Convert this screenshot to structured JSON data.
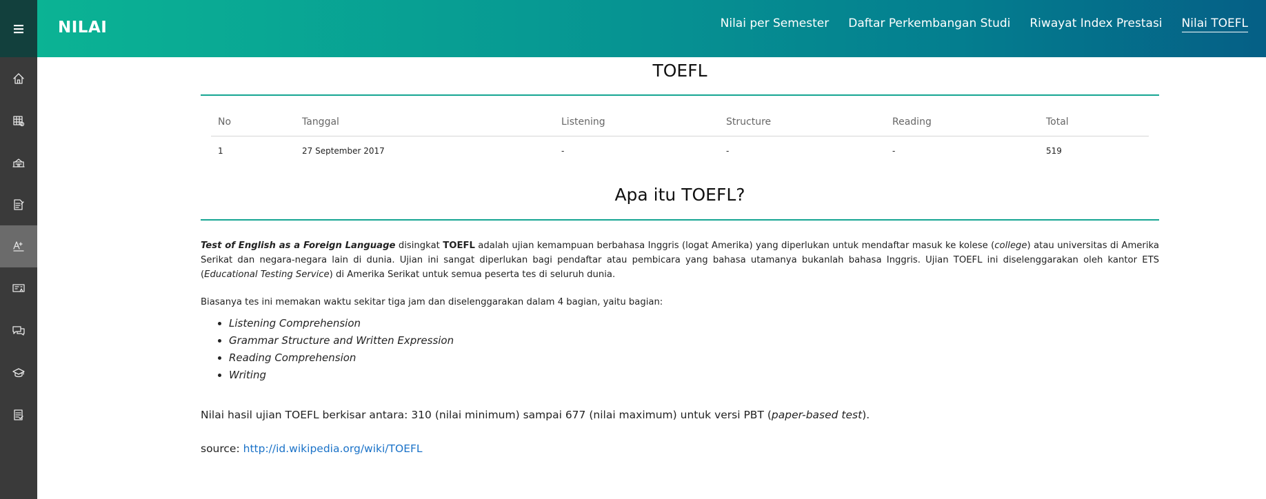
{
  "header": {
    "brand": "NILAI",
    "nav": [
      {
        "label": "Nilai per Semester",
        "active": false
      },
      {
        "label": "Daftar Perkembangan Studi",
        "active": false
      },
      {
        "label": "Riwayat Index Prestasi",
        "active": false
      },
      {
        "label": "Nilai TOEFL",
        "active": true
      }
    ]
  },
  "sidebar": {
    "items": [
      {
        "icon": "home-icon"
      },
      {
        "icon": "schedule-grid-icon"
      },
      {
        "icon": "building-icon"
      },
      {
        "icon": "document-edit-icon"
      },
      {
        "icon": "grade-icon",
        "active": true
      },
      {
        "icon": "presentation-icon"
      },
      {
        "icon": "chat-icon"
      },
      {
        "icon": "graduation-cap-icon"
      },
      {
        "icon": "checklist-icon"
      }
    ]
  },
  "main": {
    "title": "TOEFL",
    "table": {
      "columns": [
        "No",
        "Tanggal",
        "Listening",
        "Structure",
        "Reading",
        "Total"
      ],
      "rows": [
        [
          "1",
          "27 September 2017",
          "-",
          "-",
          "-",
          "519"
        ]
      ]
    },
    "about_title": "Apa itu TOEFL?",
    "p1": {
      "t1": "Test of English as a Foreign Language",
      "t2": " disingkat ",
      "t3": "TOEFL",
      "t4": " adalah ujian kemampuan berbahasa Inggris (logat Amerika) yang diperlukan untuk mendaftar masuk ke kolese (",
      "t5": "college",
      "t6": ") atau universitas di Amerika Serikat dan negara-negara lain di dunia. Ujian ini sangat diperlukan bagi pendaftar atau pembicara yang bahasa utamanya bukanlah bahasa Inggris. Ujian TOEFL ini diselenggarakan oleh kantor ETS (",
      "t7": "Educational Testing Service",
      "t8": ") di Amerika Serikat untuk semua peserta tes di seluruh dunia."
    },
    "p2": "Biasanya tes ini memakan waktu sekitar tiga jam dan diselenggarakan dalam 4 bagian, yaitu bagian:",
    "bullets": [
      "Listening Comprehension",
      "Grammar Structure and Written Expression",
      "Reading Comprehension",
      "Writing"
    ],
    "p3": {
      "t1": "Nilai hasil ujian TOEFL berkisar antara: 310 (nilai minimum) sampai 677 (nilai maximum) untuk versi PBT (",
      "t2": "paper-based test",
      "t3": ")."
    },
    "source": {
      "label": "source: ",
      "link": "http://id.wikipedia.org/wiki/TOEFL"
    }
  },
  "colors": {
    "accent": "#15a592",
    "link": "#1a72c8",
    "sidebar": "#3a3a3a"
  }
}
